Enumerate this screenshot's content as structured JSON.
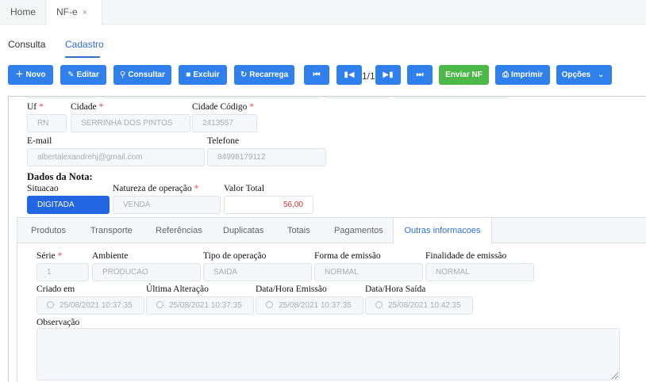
{
  "topbar": {
    "tabs": [
      {
        "label": "Home"
      },
      {
        "label": "NF-e",
        "close": "×"
      }
    ]
  },
  "subtabs": [
    {
      "label": "Consulta",
      "active": false
    },
    {
      "label": "Cadastro",
      "active": true
    }
  ],
  "toolbar": {
    "novo": "Novo",
    "editar": "Editar",
    "consultar": "Consultar",
    "excluir": "Excluir",
    "recarrega": "Recarrega",
    "first": "⏮",
    "prev": "⏮",
    "pager": "1/1",
    "next": "⏭",
    "last": "⏭",
    "enviar_nf": "Enviar NF",
    "imprimir": "Imprimir",
    "opcoes": "Opções"
  },
  "form": {
    "uf": {
      "label": "Uf",
      "required": "*",
      "value": "RN"
    },
    "cidade": {
      "label": "Cidade",
      "required": "*",
      "value": "SERRINHA DOS PINTOS"
    },
    "cidade_codigo": {
      "label": "Cidade Código",
      "required": "*",
      "value": "2413557"
    },
    "email": {
      "label": "E-mail",
      "value": "albertalexandrehj@gmail.com"
    },
    "telefone": {
      "label": "Telefone",
      "value": "84998179112"
    },
    "dados_nota_title": "Dados da Nota:",
    "situacao": {
      "label": "Situacao",
      "value": "DIGITADA"
    },
    "natureza": {
      "label": "Natureza de operação",
      "required": "*",
      "value": "VENDA"
    },
    "valor_total": {
      "label": "Valor Total",
      "value": "56,00"
    }
  },
  "detail_tabs": [
    "Produtos",
    "Transporte",
    "Referências",
    "Duplicatas",
    "Totais",
    "Pagamentos",
    "Outras informacoes"
  ],
  "outras": {
    "serie": {
      "label": "Série",
      "required": "*",
      "value": "1"
    },
    "ambiente": {
      "label": "Ambiente",
      "value": "PRODUCAO"
    },
    "tipo_operacao": {
      "label": "Tipo de operação",
      "value": "SAIDA"
    },
    "forma_emissao": {
      "label": "Forma de emissão",
      "value": "NORMAL"
    },
    "finalidade": {
      "label": "Finalidade de emissão",
      "value": "NORMAL"
    },
    "criado_em": {
      "label": "Criado em",
      "value": "25/08/2021 10:37:35"
    },
    "ultima_alteracao": {
      "label": "Última Alteração",
      "value": "25/08/2021 10:37:35"
    },
    "data_emissao": {
      "label": "Data/Hora Emissão",
      "value": "25/08/2021 10:37:35"
    },
    "data_saida": {
      "label": "Data/Hora Saída",
      "value": "25/08/2021 10:42:35"
    },
    "observacao": {
      "label": "Observação",
      "value": ""
    }
  },
  "colors": {
    "primary": "#2f80ed",
    "green": "#4cb848",
    "active_tab": "#2f6fd1",
    "danger": "#d0342c"
  }
}
